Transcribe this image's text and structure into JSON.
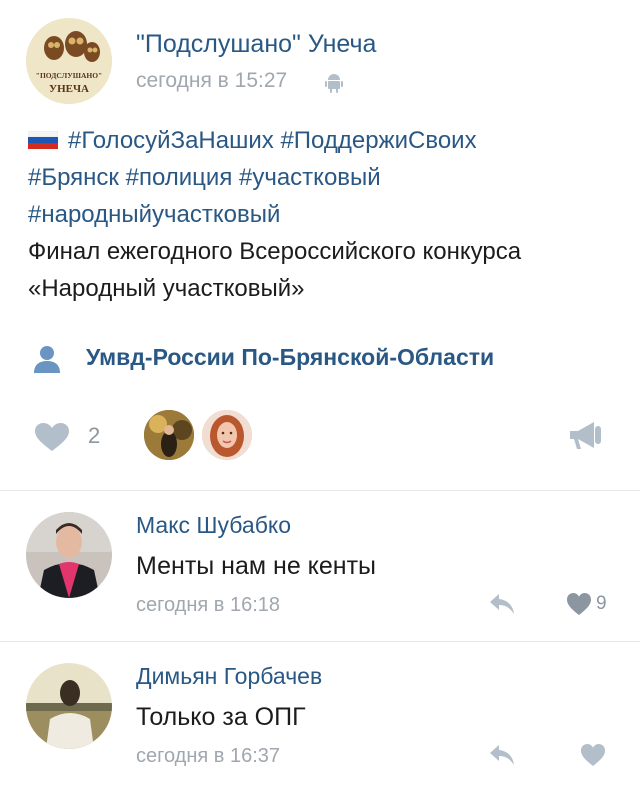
{
  "post": {
    "group_name": "\"Подслушано\" Унеча",
    "time": "сегодня в 15:27",
    "avatar_text_top": "\"ПОДСЛУШАНО\"",
    "avatar_text_bottom": "УНЕЧА",
    "hashtag_line1": "#ГолосуйЗаНаших #ПоддержиСвоих",
    "hashtag_line2": "#Брянск #полиция #участковый",
    "hashtag_line3": "#народныйучастковый",
    "text_line1": "Финал ежегодного Всероссийского конкурса",
    "text_line2": "«Народный участковый»",
    "signer": "Умвд-России По-Брянской-Области",
    "likes": "2",
    "icons": {
      "platform": "android-icon",
      "flag": "russia-flag-icon",
      "signer": "person-icon",
      "like": "heart-icon",
      "share": "megaphone-share-icon"
    }
  },
  "comments": [
    {
      "author": "Макс Шубабко",
      "text": "Менты нам не кенты",
      "time": "сегодня в 16:18",
      "likes": "9"
    },
    {
      "author": "Димьян Горбачев",
      "text": "Только за ОПГ",
      "time": "сегодня в 16:37",
      "likes": ""
    }
  ],
  "colors": {
    "link": "#2a5885",
    "meta": "#a0a7ae",
    "icon": "#b2bec9",
    "divider": "#e7e8ec"
  }
}
